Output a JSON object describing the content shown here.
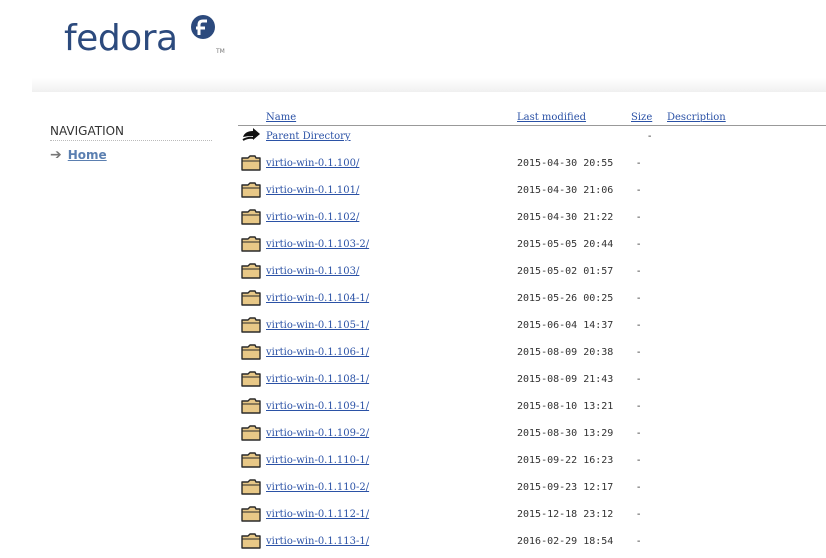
{
  "logo": {
    "wordmark": "fedora",
    "tm": "TM",
    "icon": "fedora-infinity-icon",
    "color": "#2c4a7d"
  },
  "nav": {
    "heading": "NAVIGATION",
    "home_label": "Home",
    "arrow_icon": "right-arrow-icon"
  },
  "table": {
    "headers": {
      "name": "Name",
      "modified": "Last modified",
      "size": "Size",
      "description": "Description"
    },
    "parent": {
      "name": "Parent Directory",
      "size": "-",
      "icon": "back-arrow-icon"
    },
    "rows": [
      {
        "name": "virtio-win-0.1.100/",
        "modified": "2015-04-30 20:55",
        "size": "-"
      },
      {
        "name": "virtio-win-0.1.101/",
        "modified": "2015-04-30 21:06",
        "size": "-"
      },
      {
        "name": "virtio-win-0.1.102/",
        "modified": "2015-04-30 21:22",
        "size": "-"
      },
      {
        "name": "virtio-win-0.1.103-2/",
        "modified": "2015-05-05 20:44",
        "size": "-"
      },
      {
        "name": "virtio-win-0.1.103/",
        "modified": "2015-05-02 01:57",
        "size": "-"
      },
      {
        "name": "virtio-win-0.1.104-1/",
        "modified": "2015-05-26 00:25",
        "size": "-"
      },
      {
        "name": "virtio-win-0.1.105-1/",
        "modified": "2015-06-04 14:37",
        "size": "-"
      },
      {
        "name": "virtio-win-0.1.106-1/",
        "modified": "2015-08-09 20:38",
        "size": "-"
      },
      {
        "name": "virtio-win-0.1.108-1/",
        "modified": "2015-08-09 21:43",
        "size": "-"
      },
      {
        "name": "virtio-win-0.1.109-1/",
        "modified": "2015-08-10 13:21",
        "size": "-"
      },
      {
        "name": "virtio-win-0.1.109-2/",
        "modified": "2015-08-30 13:29",
        "size": "-"
      },
      {
        "name": "virtio-win-0.1.110-1/",
        "modified": "2015-09-22 16:23",
        "size": "-"
      },
      {
        "name": "virtio-win-0.1.110-2/",
        "modified": "2015-09-23 12:17",
        "size": "-"
      },
      {
        "name": "virtio-win-0.1.112-1/",
        "modified": "2015-12-18 23:12",
        "size": "-"
      },
      {
        "name": "virtio-win-0.1.113-1/",
        "modified": "2016-02-29 18:54",
        "size": "-"
      }
    ],
    "folder_icon": "folder-icon",
    "link_color": "#2b52a6"
  }
}
